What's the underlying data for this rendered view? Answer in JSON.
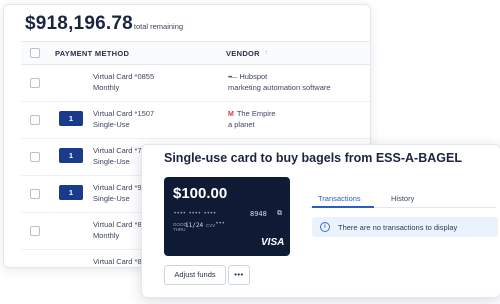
{
  "summary": {
    "amount": "$918,196.78",
    "label": "total remaining"
  },
  "table": {
    "columns": {
      "payment_method": "PAYMENT METHOD",
      "vendor": "VENDOR"
    },
    "rows": [
      {
        "badge": "",
        "card": "Virtual Card *0855",
        "type": "Monthly",
        "vendor": "Hubspot",
        "vendor_desc": "marketing automation software",
        "logo": "hubspot-logo"
      },
      {
        "badge": "1",
        "card": "Virtual Card *1507",
        "type": "Single-Use",
        "vendor": "The Empire",
        "vendor_desc": "a planet",
        "logo": "empire-logo"
      },
      {
        "badge": "1",
        "card": "Virtual Card *7",
        "type": "Single-Use",
        "vendor": "",
        "vendor_desc": "",
        "logo": ""
      },
      {
        "badge": "1",
        "card": "Virtual Card *9",
        "type": "Single-Use",
        "vendor": "",
        "vendor_desc": "",
        "logo": ""
      },
      {
        "badge": "",
        "card": "Virtual Card *8",
        "type": "Monthly",
        "vendor": "",
        "vendor_desc": "",
        "logo": ""
      },
      {
        "badge": "",
        "card": "Virtual Card *8",
        "type": "",
        "vendor": "",
        "vendor_desc": "",
        "logo": ""
      }
    ]
  },
  "detail": {
    "title": "Single-use card to buy bagels from ESS-A-BAGEL",
    "card": {
      "amount": "$100.00",
      "masked_dots": "•••• •••• ••••",
      "last4": "8948",
      "good_thru_label": "GOOD THRU",
      "expiry": "11/24",
      "cvv_label": "CVV",
      "cvv_dots": "•••",
      "network": "VISA"
    },
    "buttons": {
      "adjust": "Adjust funds",
      "more": "•••"
    },
    "tabs": [
      "Transactions",
      "History"
    ],
    "active_tab": "Transactions",
    "info_message": "There are no transactions to display"
  },
  "colors": {
    "accent": "#2c5cc5",
    "badge": "#1a3a8c",
    "card_bg": "#0f1b35",
    "info_bg": "#eaf2fb"
  }
}
